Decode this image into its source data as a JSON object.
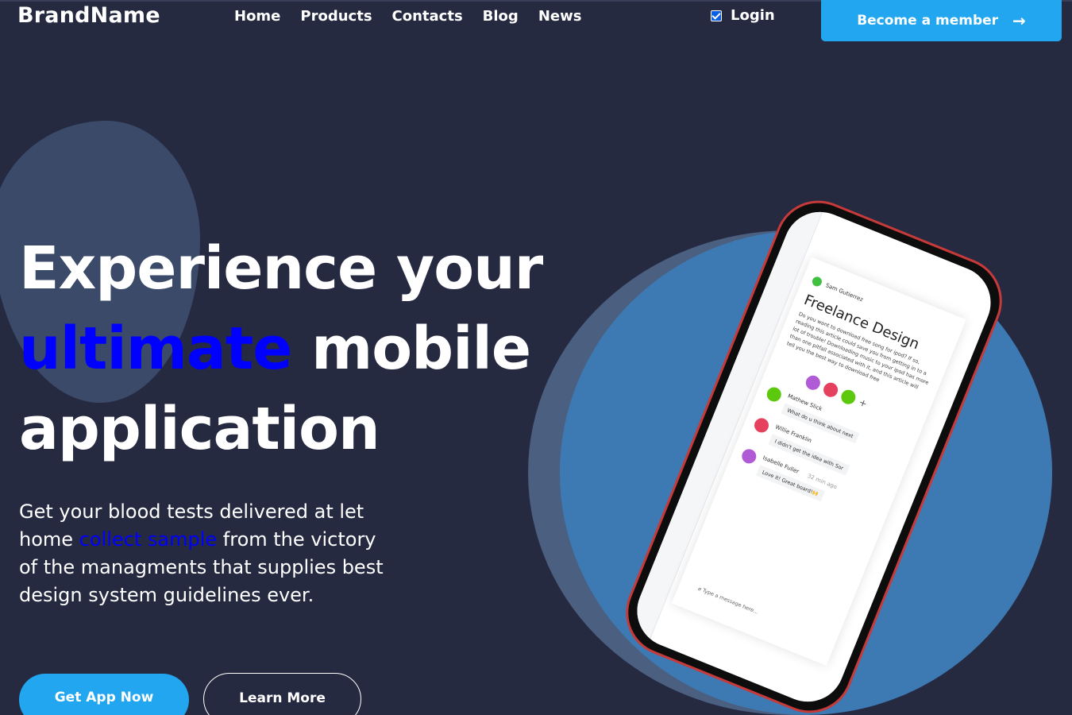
{
  "brand": "BrandName",
  "nav": {
    "items": [
      "Home",
      "Products",
      "Contacts",
      "Blog",
      "News"
    ],
    "login_label": "Login",
    "login_checked": true,
    "member_button": "Become a member",
    "member_arrow": "→"
  },
  "hero": {
    "headline_part1": "Experience your",
    "headline_highlight": "ultimate",
    "headline_part2": " mobile",
    "headline_part3": "application",
    "desc_part1": "Get your blood tests delivered at let home ",
    "desc_highlight": "collect sample",
    "desc_part2": " from the victory of the managments that supplies best design system guidelines ever.",
    "primary_button": "Get App Now",
    "secondary_button": "Learn More"
  },
  "phone": {
    "header_user": "Sam Gutierrez",
    "card_title": "Freelance Design",
    "card_text": "Do you want to download free song for ipod? If so, reading this article could save you from getting in to a lot of trouble! Downloading music to your ipod has more than one pitfall associated with it, and this article will tell you the best way to download free",
    "messages": [
      {
        "name": "Mathew Slick",
        "text": "What do u think about next"
      },
      {
        "name": "Willie Franklin",
        "text": "I didn't get the idea with Sor"
      },
      {
        "name": "Isabelle Fuller",
        "time": "32 min ago",
        "text": "Love it! Great board!🙌"
      }
    ],
    "composer_placeholder": "Type a message here..."
  },
  "colors": {
    "background": "#262a41",
    "accent": "#23a6f0",
    "highlight": "#0000ff"
  }
}
